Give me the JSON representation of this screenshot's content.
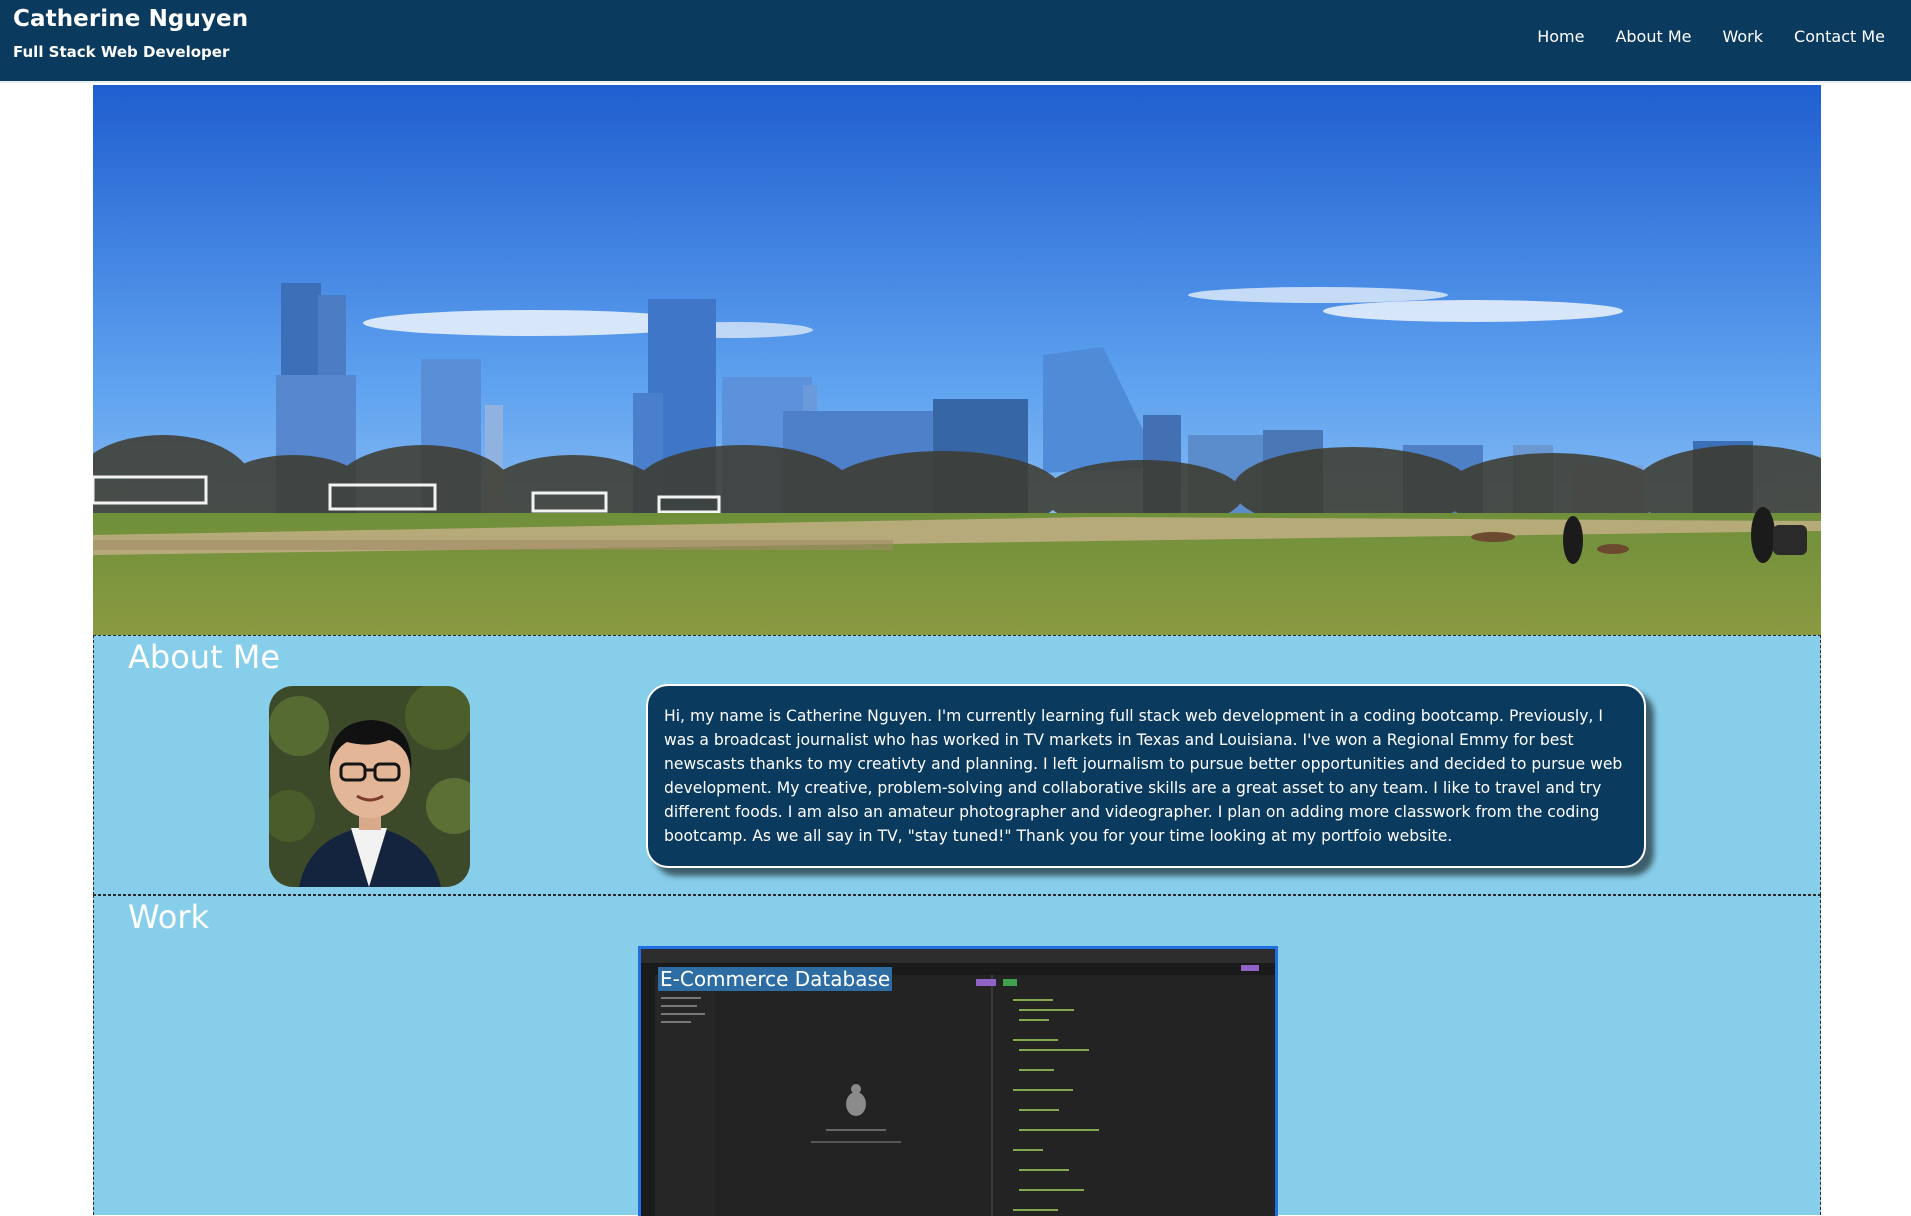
{
  "header": {
    "name": "Catherine Nguyen",
    "subtitle": "Full Stack Web Developer",
    "nav": [
      "Home",
      "About Me",
      "Work",
      "Contact Me"
    ]
  },
  "about": {
    "title": "About Me",
    "bio": "Hi, my name is Catherine Nguyen. I'm currently learning full stack web development in a coding bootcamp. Previously, I was a broadcast journalist who has worked in TV markets in Texas and Louisiana. I've won a Regional Emmy for best newscasts thanks to my creativty and planning. I left journalism to pursue better opportunities and decided to pursue web development. My creative, problem-solving and collaborative skills are a great asset to any team. I like to travel and try different foods. I am also an amateur photographer and videographer. I plan on adding more classwork from the coding bootcamp. As we all say in TV, \"stay tuned!\" Thank you for your time looking at my portfoio website."
  },
  "work": {
    "title": "Work",
    "projects": [
      {
        "label": "E-Commerce Database"
      }
    ]
  },
  "colors": {
    "header_bg": "#0b3a5f",
    "section_bg": "#87ceea",
    "card_bg": "#0b3a5f",
    "project_border": "#1f6fe0"
  },
  "icons": [
    "city-skyline-photo",
    "profile-photo",
    "project-screenshot"
  ]
}
